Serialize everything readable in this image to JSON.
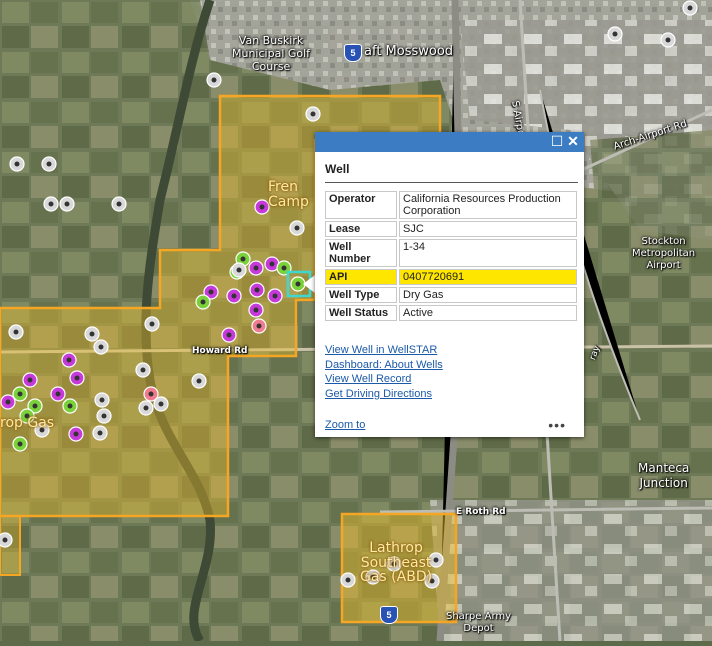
{
  "map": {
    "labels": {
      "van_buskirk": "Van Buskirk\nMunicipal Golf\nCourse",
      "mosswood": "aft Mosswood",
      "airport_way": "S Airport Wa",
      "arch_airport": "Arch-Airport Rd",
      "stockton_airport": "Stockton\nMetropolitan\nAirport",
      "howard_rd": "Howard Rd",
      "manteca_junction": "Manteca\nJunction",
      "e_roth_rd": "E Roth Rd",
      "sharpe_depot": "Sharpe Army\nDepot",
      "ray": "ray"
    },
    "field_labels": {
      "french_camp": "Fren\nCamp",
      "lathrop_gas": "rop Gas",
      "lathrop_southeast": "Lathrop\nSoutheast\nGas (ABD)"
    },
    "route_shield": "5",
    "colors": {
      "field_outline": "#f5a623",
      "field_fill": "rgba(240,190,40,0.45)",
      "well_active": "#c53ad9",
      "well_green": "#7ad13a",
      "well_pink": "#f07b8f",
      "well_gray": "#d8d8d8",
      "highlight": "#3fd8d0"
    }
  },
  "popup": {
    "title": "Well",
    "buttons": {
      "maximize": "☐",
      "close": "✕"
    },
    "attributes": [
      {
        "key": "Operator",
        "value": "California Resources Production Corporation"
      },
      {
        "key": "Lease",
        "value": "SJC"
      },
      {
        "key": "Well Number",
        "value": "1-34"
      },
      {
        "key": "API",
        "value": "0407720691"
      },
      {
        "key": "Well Type",
        "value": "Dry Gas"
      },
      {
        "key": "Well Status",
        "value": "Active"
      }
    ],
    "links": [
      "View Well in WellSTAR",
      "Dashboard: About Wells",
      "View Well Record",
      "Get Driving Directions"
    ],
    "zoom_label": "Zoom to",
    "more_label": "•••"
  }
}
